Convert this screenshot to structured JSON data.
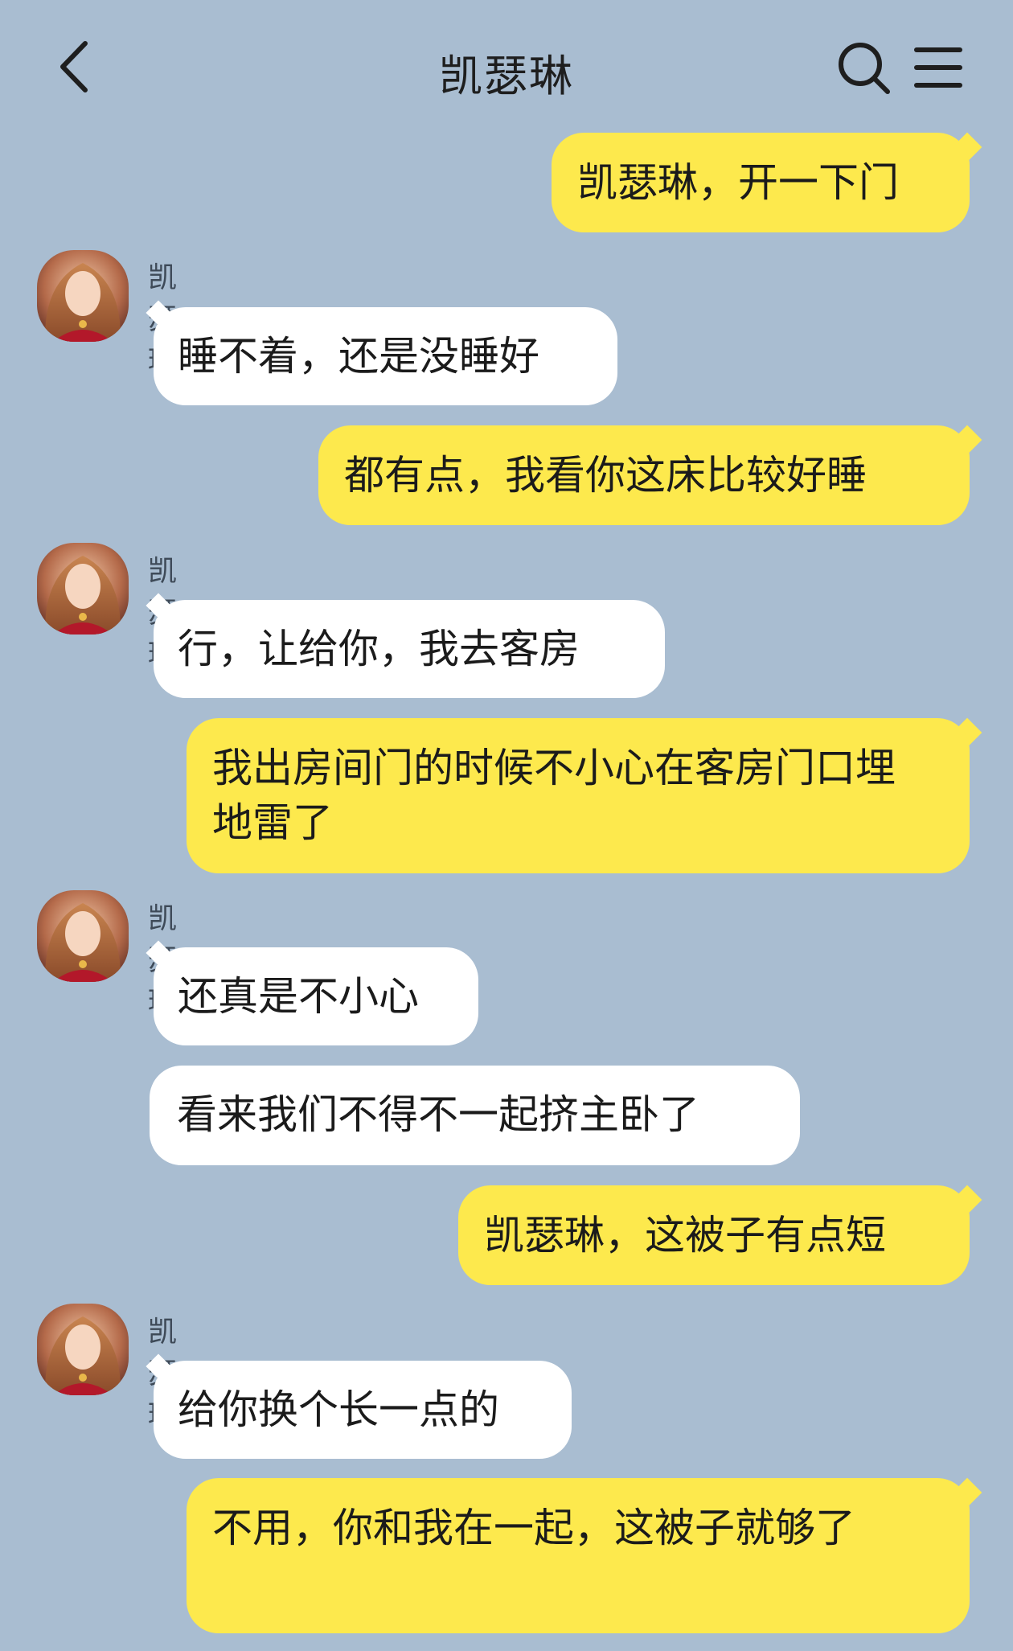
{
  "header": {
    "title": "凯瑟琳",
    "back_icon": "chevron-left-icon",
    "search_icon": "search-icon",
    "menu_icon": "menu-icon"
  },
  "colors": {
    "background": "#a9bdd1",
    "outgoing_bubble": "#fde94d",
    "incoming_bubble": "#ffffff"
  },
  "messages": [
    {
      "direction": "out",
      "text": "凯瑟琳，开一下门"
    },
    {
      "direction": "in",
      "sender": "凯瑟琳",
      "text": "睡不着，还是没睡好"
    },
    {
      "direction": "out",
      "text": "都有点，我看你这床比较好睡"
    },
    {
      "direction": "in",
      "sender": "凯瑟琳",
      "text": "行，让给你，我去客房"
    },
    {
      "direction": "out",
      "text": "我出房间门的时候不小心在客房门口埋地雷了"
    },
    {
      "direction": "in",
      "sender": "凯瑟琳",
      "text": "还真是不小心"
    },
    {
      "direction": "in",
      "text": "看来我们不得不一起挤主卧了"
    },
    {
      "direction": "out",
      "text": "凯瑟琳，这被子有点短"
    },
    {
      "direction": "in",
      "sender": "凯瑟琳",
      "text": "给你换个长一点的"
    },
    {
      "direction": "out",
      "text": "不用，你和我在一起，这被子就够了"
    }
  ]
}
